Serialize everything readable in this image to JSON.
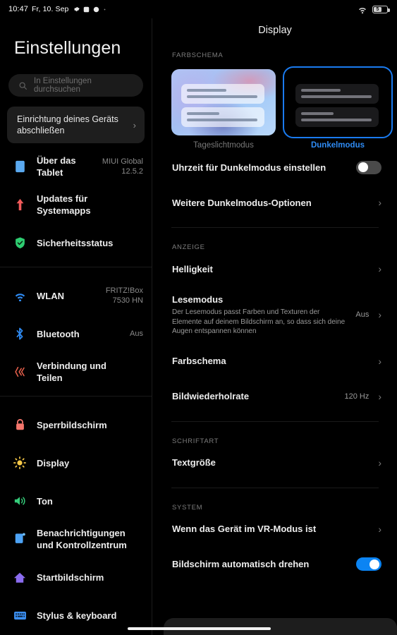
{
  "status_bar": {
    "time": "10:47",
    "date": "Fr, 10. Sep",
    "icons": [
      "gear-icon",
      "square-icon",
      "circle-icon",
      "dot-icon"
    ],
    "wifi_icon": "wifi-icon",
    "battery_level": "5"
  },
  "sidebar": {
    "title": "Einstellungen",
    "search": {
      "placeholder": "In Einstellungen durchsuchen",
      "icon": "search-icon"
    },
    "setup_card": {
      "label": "Einrichtung deines Geräts abschließen",
      "chevron": "›"
    },
    "groups": [
      {
        "items": [
          {
            "icon": "tablet-icon",
            "label": "Über das Tablet",
            "value": "MIUI Global\n12.5.2",
            "color": "#5aa9f0"
          },
          {
            "icon": "update-arrow-icon",
            "label": "Updates für Systemapps",
            "value": "",
            "color": "#f05a5a"
          },
          {
            "icon": "shield-check-icon",
            "label": "Sicherheitsstatus",
            "value": "",
            "color": "#2ecc71"
          }
        ]
      },
      {
        "items": [
          {
            "icon": "wifi-icon",
            "label": "WLAN",
            "value": "FRITZ!Box\n7530 HN",
            "color": "#2f8cf5"
          },
          {
            "icon": "bluetooth-icon",
            "label": "Bluetooth",
            "value": "Aus",
            "color": "#2f8cf5"
          },
          {
            "icon": "connection-share-icon",
            "label": "Verbindung und Teilen",
            "value": "",
            "color": "#e8604c"
          }
        ]
      },
      {
        "items": [
          {
            "icon": "lock-icon",
            "label": "Sperrbildschirm",
            "value": "",
            "color": "#f4766c"
          },
          {
            "icon": "brightness-sun-icon",
            "label": "Display",
            "value": "",
            "color": "#f7c948"
          },
          {
            "icon": "speaker-icon",
            "label": "Ton",
            "value": "",
            "color": "#35cc7a"
          },
          {
            "icon": "notification-icon",
            "label": "Benachrichtigungen und Kontrollzentrum",
            "value": "",
            "color": "#4da3f5"
          },
          {
            "icon": "home-icon",
            "label": "Startbildschirm",
            "value": "",
            "color": "#8b6cf0"
          },
          {
            "icon": "keyboard-icon",
            "label": "Stylus & keyboard",
            "value": "",
            "color": "#3b8ef0"
          }
        ]
      }
    ]
  },
  "main": {
    "title": "Display",
    "sections": [
      {
        "label": "FARBSCHEMA",
        "themes": [
          {
            "caption": "Tageslichtmodus",
            "selected": false
          },
          {
            "caption": "Dunkelmodus",
            "selected": true
          }
        ],
        "rows": [
          {
            "title": "Uhrzeit für Dunkelmodus einstellen",
            "sub": "",
            "value": "",
            "control": "toggle",
            "toggle_on": false
          },
          {
            "title": "Weitere Dunkelmodus-Optionen",
            "sub": "",
            "value": "",
            "control": "chevron",
            "chevron": "›"
          }
        ]
      },
      {
        "label": "ANZEIGE",
        "rows": [
          {
            "title": "Helligkeit",
            "sub": "",
            "value": "",
            "control": "chevron",
            "chevron": "›"
          },
          {
            "title": "Lesemodus",
            "sub": "Der Lesemodus passt Farben und Texturen der Elemente auf deinem Bildschirm an, so dass sich deine Augen entspannen können",
            "value": "Aus",
            "control": "chevron",
            "chevron": "›"
          },
          {
            "title": "Farbschema",
            "sub": "",
            "value": "",
            "control": "chevron",
            "chevron": "›"
          },
          {
            "title": "Bildwiederholrate",
            "sub": "",
            "value": "120 Hz",
            "control": "chevron",
            "chevron": "›"
          }
        ]
      },
      {
        "label": "SCHRIFTART",
        "rows": [
          {
            "title": "Textgröße",
            "sub": "",
            "value": "",
            "control": "chevron",
            "chevron": "›"
          }
        ]
      },
      {
        "label": "SYSTEM",
        "rows": [
          {
            "title": "Wenn das Gerät im VR-Modus ist",
            "sub": "",
            "value": "",
            "control": "chevron",
            "chevron": "›"
          },
          {
            "title": "Bildschirm automatisch drehen",
            "sub": "",
            "value": "",
            "control": "toggle",
            "toggle_on": true
          }
        ]
      }
    ]
  },
  "colors": {
    "accent": "#2f8cf5",
    "toggle_on": "#0b84f3",
    "toggle_off": "#4a4a4a",
    "background": "#000000"
  }
}
